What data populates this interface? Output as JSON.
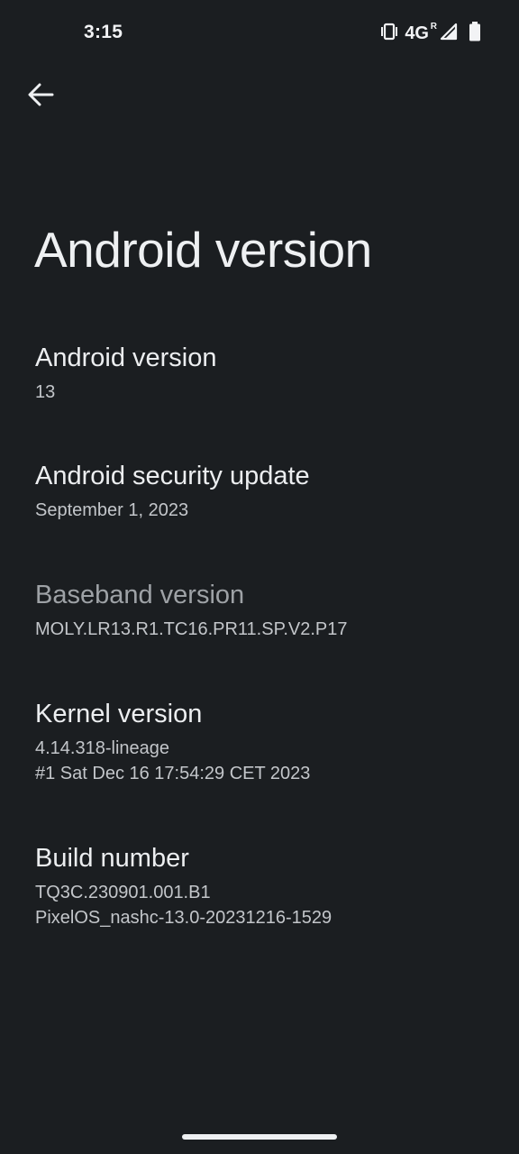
{
  "status_bar": {
    "time": "3:15",
    "network": "4G",
    "roaming": "R",
    "icons": [
      "vibrate-icon",
      "signal-icon",
      "battery-icon"
    ]
  },
  "header": {
    "back_icon": "arrow-back-icon",
    "title": "Android version"
  },
  "items": [
    {
      "title": "Android version",
      "summary_lines": [
        "13"
      ]
    },
    {
      "title": "Android security update",
      "summary_lines": [
        "September 1, 2023"
      ]
    },
    {
      "title": "Baseband version",
      "summary_lines": [
        "MOLY.LR13.R1.TC16.PR11.SP.V2.P17"
      ]
    },
    {
      "title": "Kernel version",
      "summary_lines": [
        "4.14.318-lineage",
        "#1 Sat Dec 16 17:54:29 CET 2023"
      ]
    },
    {
      "title": "Build number",
      "summary_lines": [
        "TQ3C.230901.001.B1",
        "PixelOS_nashc-13.0-20231216-1529"
      ]
    }
  ],
  "colors": {
    "background": "#1b1e21",
    "text_primary": "#eceef0",
    "text_secondary": "#c3c6ca",
    "text_disabled": "#9ea2a6"
  }
}
